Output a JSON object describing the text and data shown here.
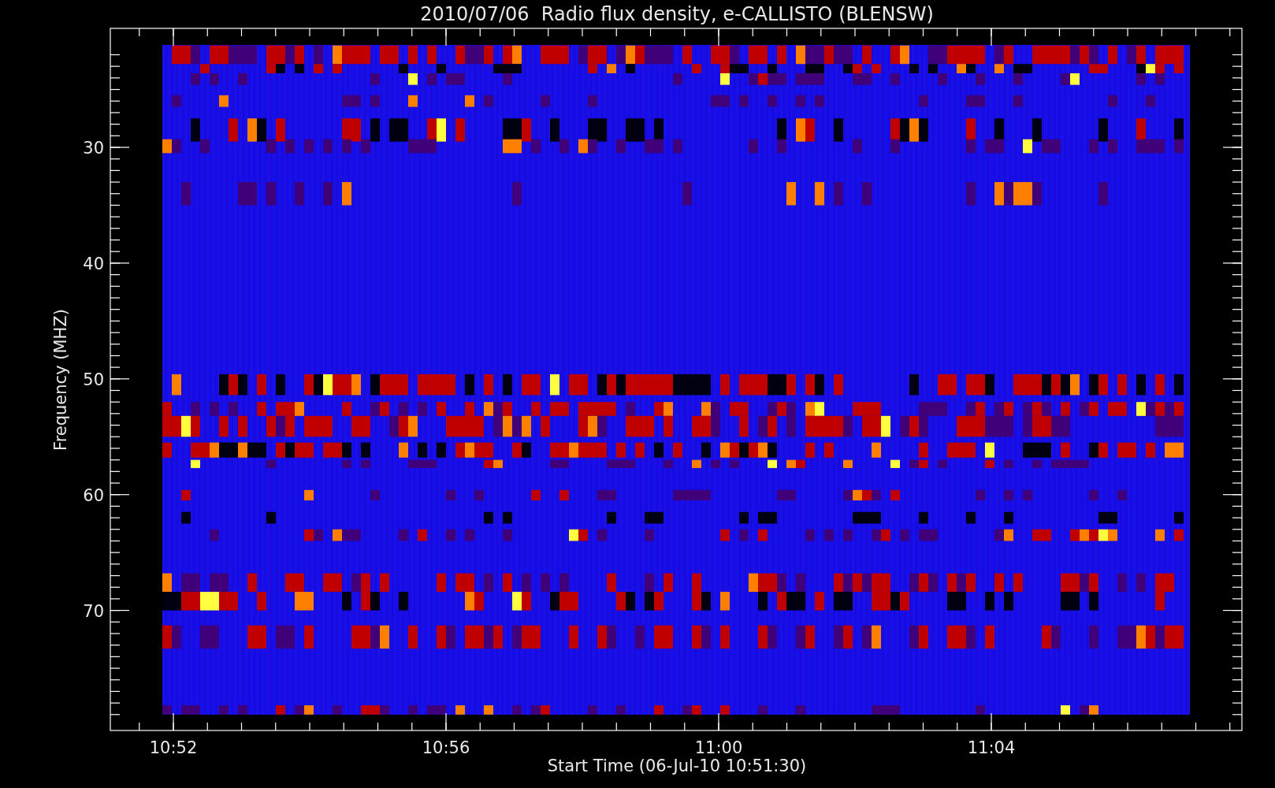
{
  "title": "2010/07/06  Radio flux density, e-CALLISTO (BLENSW)",
  "plot": {
    "ylabel": "Frequency (MHZ)",
    "xlabel": "Start Time (06-Jul-10 10:51:30)",
    "yticks": [
      "30",
      "40",
      "50",
      "60",
      "70"
    ],
    "xticks": [
      "10:52",
      "10:56",
      "11:00",
      "11:04"
    ]
  }
}
